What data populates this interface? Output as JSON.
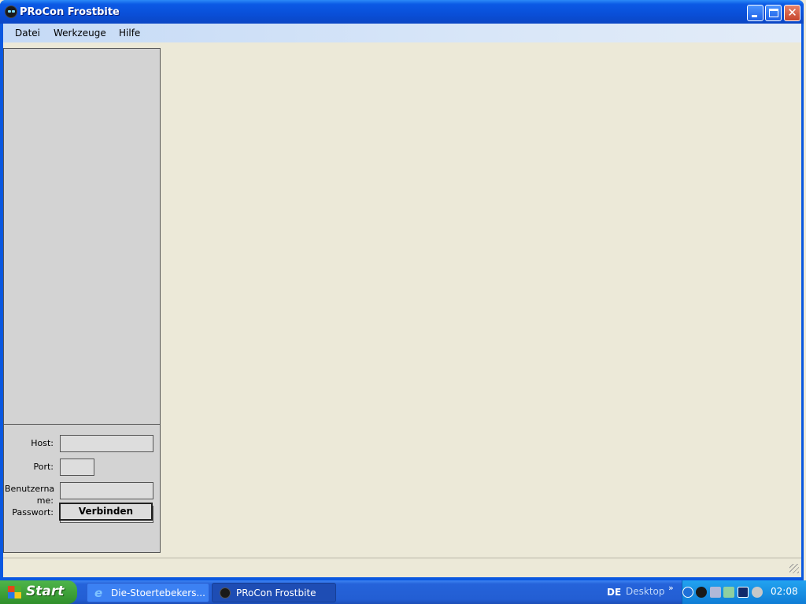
{
  "window": {
    "title": "PRoCon Frostbite",
    "close_glyph": "✕"
  },
  "menu": [
    {
      "label": "Datei"
    },
    {
      "label": "Werkzeuge"
    },
    {
      "label": "Hilfe"
    }
  ],
  "login": {
    "host_label": "Host:",
    "port_label": "Port:",
    "username_label_line1": "Benutzerna",
    "username_label_line2": "me:",
    "password_label": "Passwort:",
    "host_value": "",
    "port_value": "",
    "username_value": "",
    "password_value": "",
    "connect_label": "Verbinden"
  },
  "taskbar": {
    "start_label": "Start",
    "tasks": [
      {
        "label": "Die-Stoertebekers...",
        "icon": "ie-icon"
      },
      {
        "label": "PRoCon Frostbite",
        "icon": "procon-icon",
        "active": true
      }
    ],
    "language": "DE",
    "desktop_label": "Desktop",
    "chevron": "»",
    "clock": "02:08"
  },
  "colors": {
    "titlebar": "#0B5AE5",
    "client_bg": "#ECE9D8",
    "panel_bg": "#D3D3D3",
    "start_green": "#3A9B36",
    "taskbar_blue": "#235ED3"
  }
}
